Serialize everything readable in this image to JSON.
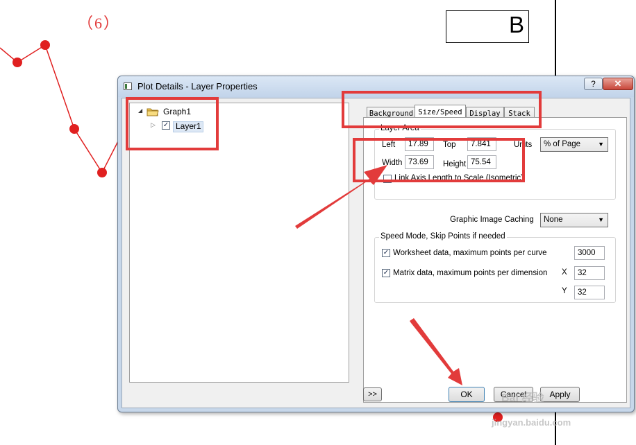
{
  "background": {
    "caption": "（6）",
    "legend_label": "B",
    "series_color": "#e02020"
  },
  "dialog": {
    "title": "Plot Details - Layer Properties",
    "help_label": "?",
    "close_label": "✕",
    "tree": {
      "root": "Graph1",
      "child": "Layer1",
      "child_checked": true
    },
    "tabs": [
      "Background",
      "Size/Speed",
      "Display",
      "Stack"
    ],
    "active_tab": "Size/Speed",
    "layer_area": {
      "group_label": "Layer Area",
      "left_label": "Left",
      "left_value": "17.89",
      "top_label": "Top",
      "top_value": "7.841",
      "units_label": "Units",
      "units_value": "% of Page",
      "width_label": "Width",
      "width_value": "73.69",
      "height_label": "Height",
      "height_value": "75.54",
      "link_label": "Link Axis Length to Scale (Isometric)",
      "link_checked": false
    },
    "caching": {
      "label": "Graphic Image Caching",
      "value": "None"
    },
    "speed": {
      "group_label": "Speed Mode, Skip Points if needed",
      "worksheet_label": "Worksheet data, maximum points per curve",
      "worksheet_checked": true,
      "worksheet_value": "3000",
      "matrix_label": "Matrix data, maximum points per dimension",
      "matrix_checked": true,
      "x_label": "X",
      "x_value": "32",
      "y_label": "Y",
      "y_value": "32"
    },
    "buttons": {
      "expand": ">>",
      "ok": "OK",
      "cancel": "Cancel",
      "apply": "Apply"
    }
  },
  "watermark": {
    "main": "Bai 经验",
    "sub": "jingyan.baidu.com"
  },
  "highlight_color": "#e23b3b"
}
